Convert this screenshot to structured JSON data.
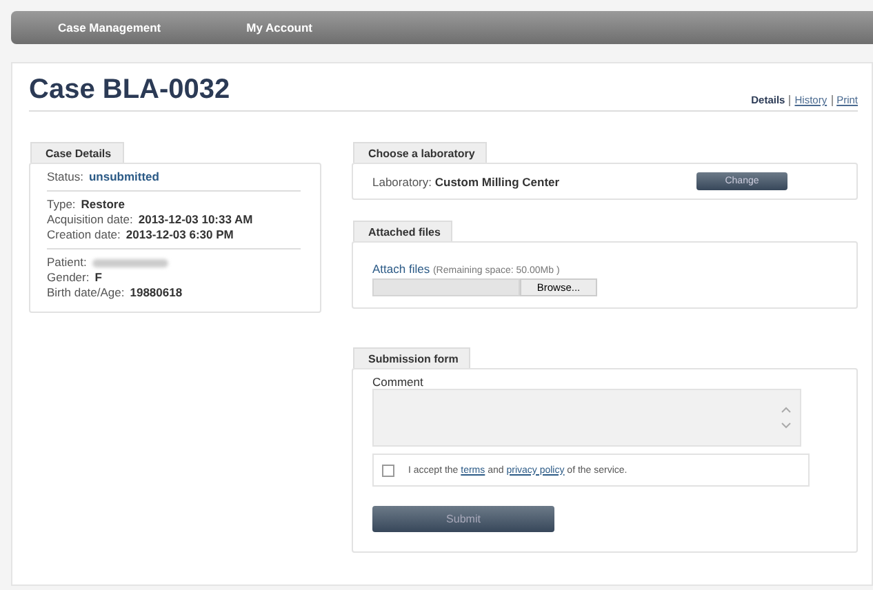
{
  "nav": [
    {
      "label": "Case Management"
    },
    {
      "label": "My Account"
    }
  ],
  "title": "Case BLA-0032",
  "view_links": [
    {
      "label": "Details",
      "selected": true
    },
    {
      "label": "History",
      "selected": false
    },
    {
      "label": "Print",
      "selected": false
    }
  ],
  "case_details": {
    "tab": "Case Details",
    "status_label": "Status:",
    "status_value": "unsubmitted",
    "group_1": [
      {
        "label": "Type:",
        "value": "Restore"
      },
      {
        "label": "Acquisition date:",
        "value": "2013-12-03 10:33 AM"
      },
      {
        "label": "Creation date:",
        "value": "2013-12-03 6:30 PM"
      }
    ],
    "group_2": [
      {
        "label": "Patient:",
        "redacted": true
      },
      {
        "label": "Gender:",
        "value": "F"
      },
      {
        "label": "Birth date/Age:",
        "value": "19880618"
      }
    ]
  },
  "laboratory": {
    "tab": "Choose a laboratory",
    "label": "Laboratory:",
    "value": "Custom Milling Center",
    "button": "Change"
  },
  "attached_files": {
    "tab": "Attached files",
    "label": "Attach files",
    "note": "(Remaining space: 50.00Mb )",
    "browse": "Browse..."
  },
  "submission": {
    "tab": "Submission form",
    "comment_label": "Comment",
    "accept": {
      "checked": false,
      "before": "I accept the",
      "link_1": "terms",
      "middle": "and",
      "link_2": "privacy policy",
      "after": "of the service."
    },
    "submit": "Submit",
    "submit_disabled": true
  }
}
